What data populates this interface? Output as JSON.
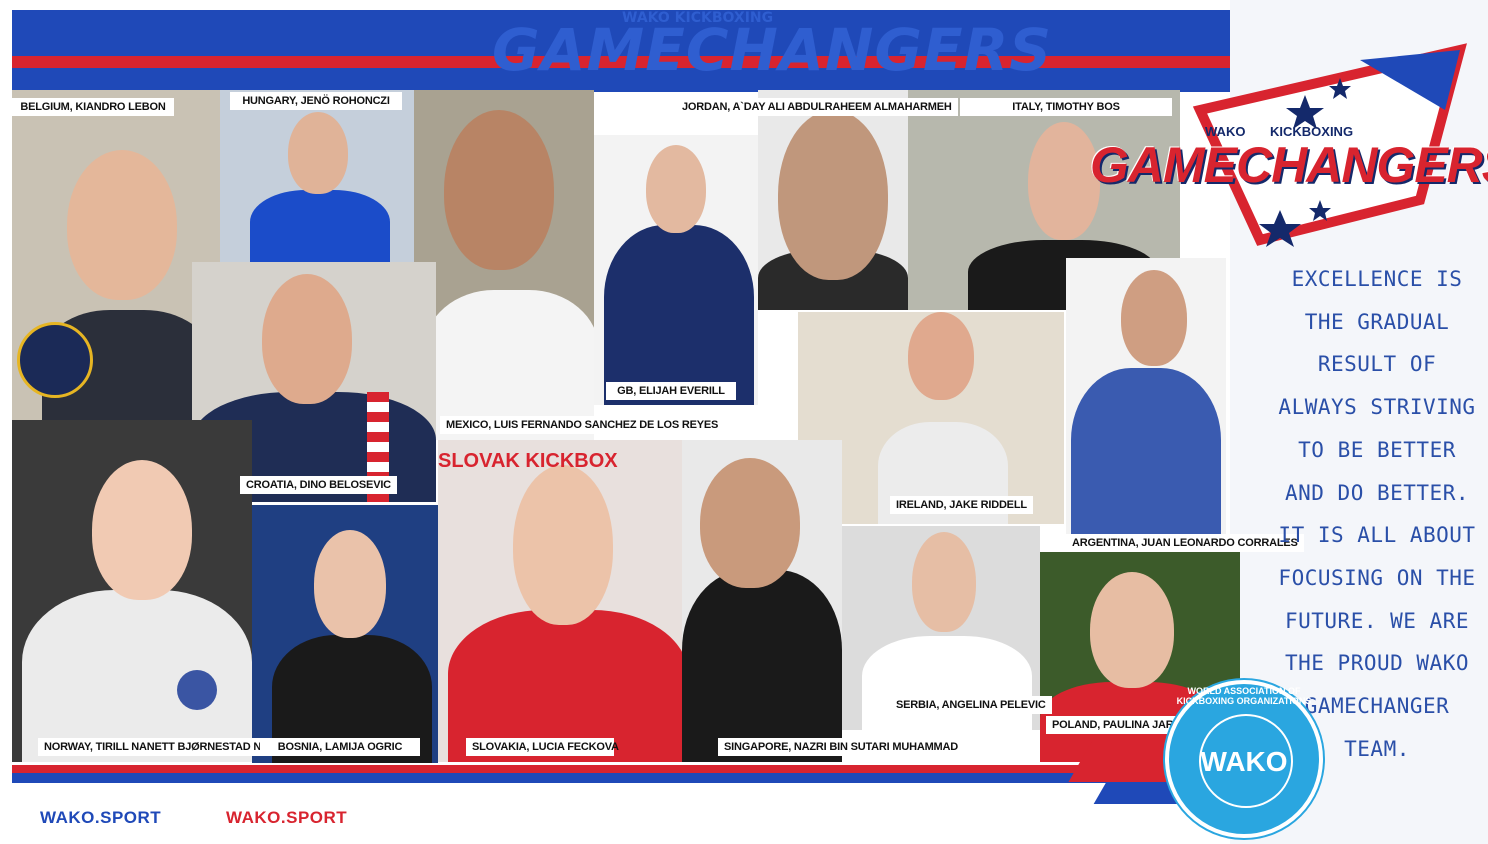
{
  "banner": {
    "ghost_small": "WAKO  KICKBOXING",
    "ghost_title": "GAMECHANGERS"
  },
  "logo": {
    "top_left": "WAKO",
    "top_right": "KICKBOXING",
    "title": "GAMECHANGERS",
    "colors": {
      "red": "#d8242f",
      "blue": "#1f49b8",
      "navy": "#14296b"
    }
  },
  "quote": {
    "lines": [
      "EXCELLENCE IS",
      "THE GRADUAL",
      "RESULT OF",
      "ALWAYS STRIVING",
      "TO BE BETTER",
      "AND DO BETTER.",
      "IT IS ALL ABOUT",
      "FOCUSING ON THE",
      "FUTURE. WE ARE",
      "THE PROUD WAKO",
      "GAMECHANGER",
      "TEAM."
    ]
  },
  "badge": {
    "center": "WAKO",
    "ring": "WORLD ASSOCIATION OF KICKBOXING ORGANIZATIONS"
  },
  "athletes": [
    "BELGIUM, KIANDRO LEBON",
    "HUNGARY, JENÖ ROHONCZI",
    "JORDAN, A`DAY ALI ABDULRAHEEM ALMAHARMEH",
    "ITALY, TIMOTHY BOS",
    "GB, ELIJAH EVERILL",
    "MEXICO, LUIS FERNANDO SANCHEZ DE LOS REYES",
    "CROATIA, DINO BELOSEVIC",
    "IRELAND, JAKE RIDDELL",
    "ARGENTINA, JUAN LEONARDO CORRALES",
    "NORWAY, TIRILL NANETT BJØRNESTAD NÆSS",
    "BOSNIA, LAMIJA OGRIC",
    "SLOVAKIA, LUCIA FECKOVA",
    "SINGAPORE, NAZRI BIN SUTARI MUHAMMAD",
    "SERBIA, ANGELINA PELEVIC",
    "POLAND, PAULINA JARZMIK"
  ],
  "footer": {
    "link_blue": "WAKO.SPORT",
    "link_red": "WAKO.SPORT",
    "blue": "#1f49b8",
    "red": "#d8242f"
  }
}
